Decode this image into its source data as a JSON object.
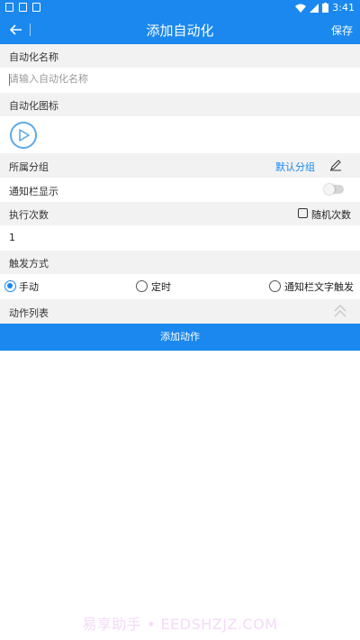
{
  "status_bar": {
    "time": "3:41"
  },
  "app_bar": {
    "title": "添加自动化",
    "save_label": "保存"
  },
  "form": {
    "name_section_label": "自动化名称",
    "name_placeholder": "请输入自动化名称",
    "name_value": "",
    "icon_section_label": "自动化图标",
    "group_label": "所属分组",
    "group_value": "默认分组",
    "notify_label": "通知栏显示",
    "notify_enabled": false,
    "exec_label": "执行次数",
    "random_label": "随机次数",
    "random_checked": false,
    "exec_count": "1",
    "trigger_label": "触发方式",
    "trigger_options": [
      "手动",
      "定时",
      "通知栏文字触发"
    ],
    "trigger_selected": "手动",
    "actions_label": "动作列表"
  },
  "add_action_label": "添加动作",
  "watermark": "易享助手 • EEDSHZJZ.COM"
}
